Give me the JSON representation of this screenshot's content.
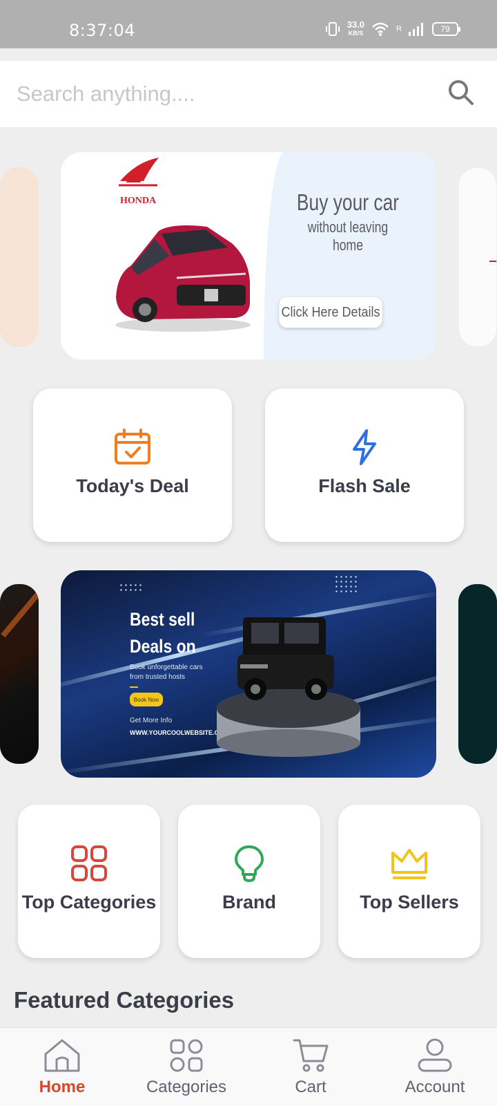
{
  "status_bar": {
    "time": "8:37:04",
    "net_speed_value": "33.0",
    "net_speed_unit": "KB/S",
    "signal_label": "R",
    "battery": "79"
  },
  "search": {
    "placeholder": "Search anything...."
  },
  "banners": {
    "top": {
      "brand": "HONDA",
      "headline": "Buy your car",
      "subheadline": "without leaving home",
      "cta": "Click Here Details",
      "accent_color": "#d11f2b"
    },
    "middle": {
      "title_line1": "Best sell",
      "title_line2": "Deals on",
      "subtitle": "Book unforgettable cars from trusted hosts",
      "button": "Book Now",
      "more_info": "Get More Info",
      "url": "WWW.YOURCOOLWEBSITE.COM"
    }
  },
  "quick_actions": [
    {
      "label": "Today's Deal",
      "icon": "calendar-check-icon",
      "color": "#ef7d22"
    },
    {
      "label": "Flash Sale",
      "icon": "lightning-icon",
      "color": "#2f6fe0"
    }
  ],
  "shortcuts": [
    {
      "label": "Top Categories",
      "icon": "categories-grid-icon",
      "color": "#d6483b"
    },
    {
      "label": "Brand",
      "icon": "lightbulb-icon",
      "color": "#2fa85a"
    },
    {
      "label": "Top Sellers",
      "icon": "crown-icon",
      "color": "#f0c419"
    }
  ],
  "featured": {
    "title": "Featured Categories"
  },
  "bottom_nav": [
    {
      "label": "Home",
      "icon": "home-icon",
      "active": true
    },
    {
      "label": "Categories",
      "icon": "categories-icon",
      "active": false
    },
    {
      "label": "Cart",
      "icon": "cart-icon",
      "active": false
    },
    {
      "label": "Account",
      "icon": "account-icon",
      "active": false
    }
  ]
}
